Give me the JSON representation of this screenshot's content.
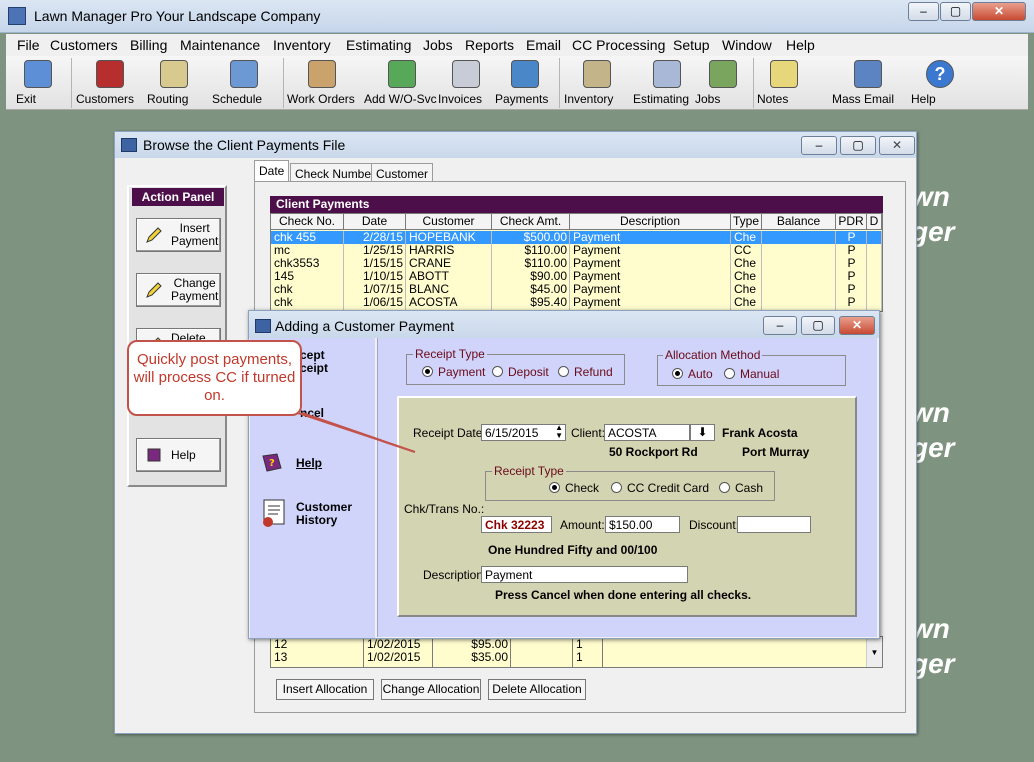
{
  "app": {
    "title": "Lawn Manager Pro  Your Landscape Company",
    "controls": [
      "–",
      "▢",
      "✕"
    ]
  },
  "menu": [
    "File",
    "Customers",
    "Billing",
    "Maintenance",
    "Inventory",
    "Estimating",
    "Jobs",
    "Reports",
    "Email",
    "CC Processing",
    "Setup",
    "Window",
    "Help"
  ],
  "toolbar": [
    {
      "label": "Exit",
      "icon": "exit-icon",
      "color": "#5d8fd6"
    },
    {
      "label": "Customers",
      "icon": "customers-icon",
      "color": "#b72e2e"
    },
    {
      "label": "Routing",
      "icon": "routing-icon",
      "color": "#d8c98f"
    },
    {
      "label": "Schedule",
      "icon": "schedule-icon",
      "color": "#6c98d3"
    },
    {
      "label": "Work Orders",
      "icon": "work-orders-icon",
      "color": "#c9a36b"
    },
    {
      "label": "Add W/O-Svc",
      "icon": "add-wo-icon",
      "color": "#58a85a"
    },
    {
      "label": "Invoices",
      "icon": "invoices-icon",
      "color": "#c8ccd6"
    },
    {
      "label": "Payments",
      "icon": "payments-icon",
      "color": "#4a87c9"
    },
    {
      "label": "Inventory",
      "icon": "inventory-icon",
      "color": "#c4b48a"
    },
    {
      "label": "Estimating",
      "icon": "estimating-icon",
      "color": "#a8b8d6"
    },
    {
      "label": "Jobs",
      "icon": "jobs-icon",
      "color": "#7aa55e"
    },
    {
      "label": "Notes",
      "icon": "notes-icon",
      "color": "#e8d77a"
    },
    {
      "label": "Mass Email",
      "icon": "mass-email-icon",
      "color": "#5c84c3"
    },
    {
      "label": "Help",
      "icon": "help-icon",
      "color": "#3b78d0"
    }
  ],
  "background_ghost": [
    "wn",
    "ger",
    "wn",
    "ger",
    "wn",
    "ger"
  ],
  "browse": {
    "title": "Browse the Client Payments File",
    "tabs": [
      "Date",
      "Check Number",
      "Customer"
    ],
    "action_panel": {
      "title": "Action Panel",
      "buttons": [
        {
          "line1": "Insert",
          "line2": "Payment"
        },
        {
          "line1": "Change",
          "line2": "Payment"
        },
        {
          "line1": "Delete",
          "line2": ""
        },
        {
          "line1": "Help",
          "line2": ""
        }
      ]
    },
    "grid_title": "Client Payments",
    "columns": [
      "Check No.",
      "Date",
      "Customer",
      "Check Amt.",
      "Description",
      "Type",
      "Balance",
      "PDR",
      "D"
    ],
    "rows": [
      {
        "check": "chk 455",
        "date": "2/28/15",
        "customer": "HOPEBANK",
        "amount": "$500.00",
        "desc": "Payment",
        "type": "Che",
        "balance": "",
        "pdr": "P",
        "selected": true
      },
      {
        "check": "mc",
        "date": "1/25/15",
        "customer": "HARRIS",
        "amount": "$110.00",
        "desc": "Payment",
        "type": "CC",
        "balance": "",
        "pdr": "P",
        "selected": false
      },
      {
        "check": "chk3553",
        "date": "1/15/15",
        "customer": "CRANE",
        "amount": "$110.00",
        "desc": "Payment",
        "type": "Che",
        "balance": "",
        "pdr": "P",
        "selected": false
      },
      {
        "check": "145",
        "date": "1/10/15",
        "customer": "ABOTT",
        "amount": "$90.00",
        "desc": "Payment",
        "type": "Che",
        "balance": "",
        "pdr": "P",
        "selected": false
      },
      {
        "check": "chk",
        "date": "1/07/15",
        "customer": "BLANC",
        "amount": "$45.00",
        "desc": "Payment",
        "type": "Che",
        "balance": "",
        "pdr": "P",
        "selected": false
      },
      {
        "check": "chk",
        "date": "1/06/15",
        "customer": "ACOSTA",
        "amount": "$95.40",
        "desc": "Payment",
        "type": "Che",
        "balance": "",
        "pdr": "P",
        "selected": false
      }
    ],
    "alloc_rows": [
      {
        "num": "12",
        "date": "1/02/2015",
        "amount": "$95.00",
        "flag": "1"
      },
      {
        "num": "13",
        "date": "1/02/2015",
        "amount": "$35.00",
        "flag": "1"
      }
    ],
    "bottom_buttons": [
      "Insert Allocation",
      "Change Allocation",
      "Delete Allocation"
    ]
  },
  "dialog": {
    "title": "Adding a Customer Payment",
    "left_options": [
      {
        "label": "Accept Receipt",
        "visible_text": "cept\nceipt"
      },
      {
        "label": "Cancel",
        "visible_text": "ncel"
      },
      {
        "label": "Help"
      },
      {
        "label": "Customer History"
      }
    ],
    "receipt_type": {
      "title": "Receipt Type",
      "options": [
        "Payment",
        "Deposit",
        "Refund"
      ],
      "selected": "Payment"
    },
    "allocation_method": {
      "title": "Allocation Method",
      "options": [
        "Auto",
        "Manual"
      ],
      "selected": "Auto"
    },
    "receipt_date_label": "Receipt Date:",
    "receipt_date": "6/15/2015",
    "client_label": "Client:",
    "client": "ACOSTA",
    "client_name": "Frank Acosta",
    "client_address": "50 Rockport Rd",
    "client_city": "Port Murray",
    "payment_type": {
      "title": "Receipt Type",
      "options": [
        "Check",
        "CC Credit Card",
        "Cash"
      ],
      "selected": "Check"
    },
    "chk_label": "Chk/Trans No.:",
    "chk_value": "Chk 32223",
    "amount_label": "Amount:",
    "amount_value": "$150.00",
    "discount_label": "Discount:",
    "discount_value": "",
    "amount_words": "One Hundred Fifty and 00/100",
    "description_label": "Description:",
    "description_value": "Payment",
    "footer_note": "Press Cancel when done entering all checks."
  },
  "callout": {
    "text": "Quickly post payments, will process CC if turned on."
  }
}
